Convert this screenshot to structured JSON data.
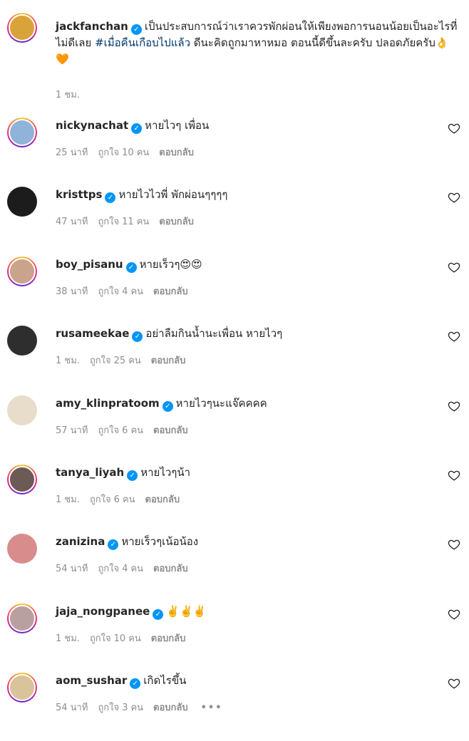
{
  "post": {
    "username": "jackfanchan",
    "caption_text": "เป็นประสบการณ์ว่าเราควรพักผ่อนให้เพียงพอการนอนน้อยเป็นอะไรที่ไม่ดีเลย ",
    "hashtag": "#เมื่อคืนเกือบไปแล้ว",
    "caption_after": " ดีนะคิดถูกมาหาหมอ ตอนนี้ดีขึ้นละครับ ปลอดภัยครับ",
    "emoji": "👌🧡",
    "time": "1 ชม."
  },
  "labels": {
    "likes_prefix": "ถูกใจ",
    "likes_suffix": "คน",
    "reply": "ตอบกลับ",
    "more": "•••"
  },
  "comments": [
    {
      "username": "nickynachat",
      "text": "หายไวๆ เพื่อน",
      "time": "25 นาที",
      "likes": "10",
      "avatar_color": "#8fb3d9"
    },
    {
      "username": "kristtps",
      "text": "หายไวไวพี่ พักผ่อนๆๆๆๆ",
      "time": "47 นาที",
      "likes": "11",
      "avatar_color": "#1c1c1c"
    },
    {
      "username": "boy_pisanu",
      "text": "หายเร็วๆ😍😍",
      "time": "38 นาที",
      "likes": "4",
      "avatar_color": "#c9a38a"
    },
    {
      "username": "rusameekae",
      "text": "อย่าลืมกินน้ำนะเพื่อน หายไวๆ",
      "time": "1 ชม.",
      "likes": "25",
      "avatar_color": "#2e2e2e"
    },
    {
      "username": "amy_klinpratoom",
      "text": "หายไวๆนะแจ๊คคคค",
      "time": "57 นาที",
      "likes": "6",
      "avatar_color": "#e8dccb"
    },
    {
      "username": "tanya_liyah",
      "text": "หายไวๆน้า",
      "time": "1 ชม.",
      "likes": "6",
      "avatar_color": "#6b5a55"
    },
    {
      "username": "zanizina",
      "text": "หายเร็วๆเน้อน้อง",
      "time": "54 นาที",
      "likes": "4",
      "avatar_color": "#d98c8c"
    },
    {
      "username": "jaja_nongpanee",
      "text": "✌️✌️✌️",
      "time": "1 ชม.",
      "likes": "10",
      "avatar_color": "#b9a0a0"
    },
    {
      "username": "aom_sushar",
      "text": "เกิดไรขึ้น",
      "time": "54 นาที",
      "likes": "3",
      "avatar_color": "#d8c39a"
    }
  ],
  "colors": {
    "verified": "#0095f6",
    "hashtag": "#00376b",
    "meta": "#8e8e8e"
  }
}
